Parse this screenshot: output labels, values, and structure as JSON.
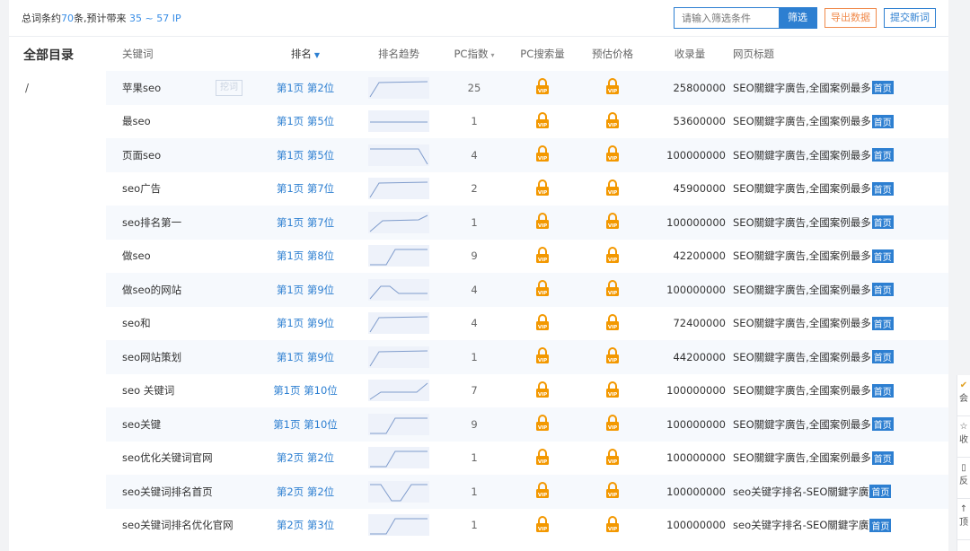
{
  "topbar": {
    "summary_prefix": "总词条约",
    "summary_count": "70",
    "summary_mid": "条,预计带来",
    "summary_ip": "35 ~ 57",
    "summary_suffix": "IP",
    "filter_placeholder": "请输入筛选条件",
    "filter_label": "筛选",
    "export_label": "导出数据",
    "submit_label": "提交新词"
  },
  "sidebar": {
    "title": "全部目录",
    "path": "/"
  },
  "table": {
    "headers": {
      "keyword": "关键词",
      "rank": "排名",
      "trend": "排名趋势",
      "pc_index": "PC指数",
      "pc_search": "PC搜索量",
      "price": "预估价格",
      "indexed": "收录量",
      "page_title": "网页标题"
    },
    "mine_tag": "挖词",
    "home_badge": "首页",
    "rows": [
      {
        "keyword": "苹果seo",
        "rank": "第1页 第2位",
        "pc": "25",
        "indexed": "25800000",
        "title": "SEO關鍵字廣告,全國案例最多",
        "trend": "up-early"
      },
      {
        "keyword": "最seo",
        "rank": "第1页 第5位",
        "pc": "1",
        "indexed": "53600000",
        "title": "SEO關鍵字廣告,全國案例最多",
        "trend": "flat"
      },
      {
        "keyword": "页面seo",
        "rank": "第1页 第5位",
        "pc": "4",
        "indexed": "100000000",
        "title": "SEO關鍵字廣告,全國案例最多",
        "trend": "down-late"
      },
      {
        "keyword": "seo广告",
        "rank": "第1页 第7位",
        "pc": "2",
        "indexed": "45900000",
        "title": "SEO關鍵字廣告,全國案例最多",
        "trend": "up-early"
      },
      {
        "keyword": "seo排名第一",
        "rank": "第1页 第7位",
        "pc": "1",
        "indexed": "100000000",
        "title": "SEO關鍵字廣告,全國案例最多",
        "trend": "up-step"
      },
      {
        "keyword": "做seo",
        "rank": "第1页 第8位",
        "pc": "9",
        "indexed": "42200000",
        "title": "SEO關鍵字廣告,全國案例最多",
        "trend": "up-mid"
      },
      {
        "keyword": "做seo的网站",
        "rank": "第1页 第9位",
        "pc": "4",
        "indexed": "100000000",
        "title": "SEO關鍵字廣告,全國案例最多",
        "trend": "bump"
      },
      {
        "keyword": "seo和",
        "rank": "第1页 第9位",
        "pc": "4",
        "indexed": "72400000",
        "title": "SEO關鍵字廣告,全國案例最多",
        "trend": "up-early"
      },
      {
        "keyword": "seo网站策划",
        "rank": "第1页 第9位",
        "pc": "1",
        "indexed": "44200000",
        "title": "SEO關鍵字廣告,全國案例最多",
        "trend": "up-early"
      },
      {
        "keyword": "seo 关键词",
        "rank": "第1页 第10位",
        "pc": "7",
        "indexed": "100000000",
        "title": "SEO關鍵字廣告,全國案例最多",
        "trend": "up-late"
      },
      {
        "keyword": "seo关键",
        "rank": "第1页 第10位",
        "pc": "9",
        "indexed": "100000000",
        "title": "SEO關鍵字廣告,全國案例最多",
        "trend": "up-mid"
      },
      {
        "keyword": "seo优化关键词官网",
        "rank": "第2页 第2位",
        "pc": "1",
        "indexed": "100000000",
        "title": "SEO關鍵字廣告,全國案例最多",
        "trend": "up-mid"
      },
      {
        "keyword": "seo关键词排名首页",
        "rank": "第2页 第2位",
        "pc": "1",
        "indexed": "100000000",
        "title": "seo关键字排名-SEO關鍵字廣",
        "trend": "dip"
      },
      {
        "keyword": "seo关键词排名优化官网",
        "rank": "第2页 第3位",
        "pc": "1",
        "indexed": "100000000",
        "title": "seo关键字排名-SEO關鍵字廣",
        "trend": "up-mid"
      }
    ]
  },
  "colors": {
    "accent": "#2d7fd1",
    "orange": "#f08a4b",
    "lock": "#f39800"
  },
  "side_panel": {
    "items": [
      "会",
      "收",
      "反",
      "顶"
    ]
  }
}
